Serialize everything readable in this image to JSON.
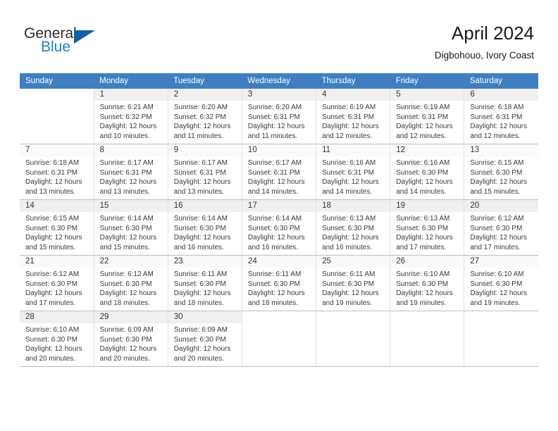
{
  "brand": {
    "name_part1": "General",
    "name_part2": "Blue",
    "triangle_icon": "triangle-logo-icon",
    "accent_color": "#1060a8",
    "blue_text_color": "#1f7fc4"
  },
  "header": {
    "title": "April 2024",
    "subtitle": "Digbohouo, Ivory Coast"
  },
  "calendar": {
    "header_bg_color": "#3f7fc1",
    "weekday_headers": [
      "Sunday",
      "Monday",
      "Tuesday",
      "Wednesday",
      "Thursday",
      "Friday",
      "Saturday"
    ],
    "weeks": [
      [
        {
          "day": "",
          "sunrise": "",
          "sunset": "",
          "daylight_line1": "",
          "daylight_line2": ""
        },
        {
          "day": "1",
          "sunrise": "Sunrise: 6:21 AM",
          "sunset": "Sunset: 6:32 PM",
          "daylight_line1": "Daylight: 12 hours",
          "daylight_line2": "and 10 minutes."
        },
        {
          "day": "2",
          "sunrise": "Sunrise: 6:20 AM",
          "sunset": "Sunset: 6:32 PM",
          "daylight_line1": "Daylight: 12 hours",
          "daylight_line2": "and 11 minutes."
        },
        {
          "day": "3",
          "sunrise": "Sunrise: 6:20 AM",
          "sunset": "Sunset: 6:31 PM",
          "daylight_line1": "Daylight: 12 hours",
          "daylight_line2": "and 11 minutes."
        },
        {
          "day": "4",
          "sunrise": "Sunrise: 6:19 AM",
          "sunset": "Sunset: 6:31 PM",
          "daylight_line1": "Daylight: 12 hours",
          "daylight_line2": "and 12 minutes."
        },
        {
          "day": "5",
          "sunrise": "Sunrise: 6:19 AM",
          "sunset": "Sunset: 6:31 PM",
          "daylight_line1": "Daylight: 12 hours",
          "daylight_line2": "and 12 minutes."
        },
        {
          "day": "6",
          "sunrise": "Sunrise: 6:18 AM",
          "sunset": "Sunset: 6:31 PM",
          "daylight_line1": "Daylight: 12 hours",
          "daylight_line2": "and 12 minutes."
        }
      ],
      [
        {
          "day": "7",
          "sunrise": "Sunrise: 6:18 AM",
          "sunset": "Sunset: 6:31 PM",
          "daylight_line1": "Daylight: 12 hours",
          "daylight_line2": "and 13 minutes."
        },
        {
          "day": "8",
          "sunrise": "Sunrise: 6:17 AM",
          "sunset": "Sunset: 6:31 PM",
          "daylight_line1": "Daylight: 12 hours",
          "daylight_line2": "and 13 minutes."
        },
        {
          "day": "9",
          "sunrise": "Sunrise: 6:17 AM",
          "sunset": "Sunset: 6:31 PM",
          "daylight_line1": "Daylight: 12 hours",
          "daylight_line2": "and 13 minutes."
        },
        {
          "day": "10",
          "sunrise": "Sunrise: 6:17 AM",
          "sunset": "Sunset: 6:31 PM",
          "daylight_line1": "Daylight: 12 hours",
          "daylight_line2": "and 14 minutes."
        },
        {
          "day": "11",
          "sunrise": "Sunrise: 6:16 AM",
          "sunset": "Sunset: 6:31 PM",
          "daylight_line1": "Daylight: 12 hours",
          "daylight_line2": "and 14 minutes."
        },
        {
          "day": "12",
          "sunrise": "Sunrise: 6:16 AM",
          "sunset": "Sunset: 6:30 PM",
          "daylight_line1": "Daylight: 12 hours",
          "daylight_line2": "and 14 minutes."
        },
        {
          "day": "13",
          "sunrise": "Sunrise: 6:15 AM",
          "sunset": "Sunset: 6:30 PM",
          "daylight_line1": "Daylight: 12 hours",
          "daylight_line2": "and 15 minutes."
        }
      ],
      [
        {
          "day": "14",
          "sunrise": "Sunrise: 6:15 AM",
          "sunset": "Sunset: 6:30 PM",
          "daylight_line1": "Daylight: 12 hours",
          "daylight_line2": "and 15 minutes."
        },
        {
          "day": "15",
          "sunrise": "Sunrise: 6:14 AM",
          "sunset": "Sunset: 6:30 PM",
          "daylight_line1": "Daylight: 12 hours",
          "daylight_line2": "and 15 minutes."
        },
        {
          "day": "16",
          "sunrise": "Sunrise: 6:14 AM",
          "sunset": "Sunset: 6:30 PM",
          "daylight_line1": "Daylight: 12 hours",
          "daylight_line2": "and 16 minutes."
        },
        {
          "day": "17",
          "sunrise": "Sunrise: 6:14 AM",
          "sunset": "Sunset: 6:30 PM",
          "daylight_line1": "Daylight: 12 hours",
          "daylight_line2": "and 16 minutes."
        },
        {
          "day": "18",
          "sunrise": "Sunrise: 6:13 AM",
          "sunset": "Sunset: 6:30 PM",
          "daylight_line1": "Daylight: 12 hours",
          "daylight_line2": "and 16 minutes."
        },
        {
          "day": "19",
          "sunrise": "Sunrise: 6:13 AM",
          "sunset": "Sunset: 6:30 PM",
          "daylight_line1": "Daylight: 12 hours",
          "daylight_line2": "and 17 minutes."
        },
        {
          "day": "20",
          "sunrise": "Sunrise: 6:12 AM",
          "sunset": "Sunset: 6:30 PM",
          "daylight_line1": "Daylight: 12 hours",
          "daylight_line2": "and 17 minutes."
        }
      ],
      [
        {
          "day": "21",
          "sunrise": "Sunrise: 6:12 AM",
          "sunset": "Sunset: 6:30 PM",
          "daylight_line1": "Daylight: 12 hours",
          "daylight_line2": "and 17 minutes."
        },
        {
          "day": "22",
          "sunrise": "Sunrise: 6:12 AM",
          "sunset": "Sunset: 6:30 PM",
          "daylight_line1": "Daylight: 12 hours",
          "daylight_line2": "and 18 minutes."
        },
        {
          "day": "23",
          "sunrise": "Sunrise: 6:11 AM",
          "sunset": "Sunset: 6:30 PM",
          "daylight_line1": "Daylight: 12 hours",
          "daylight_line2": "and 18 minutes."
        },
        {
          "day": "24",
          "sunrise": "Sunrise: 6:11 AM",
          "sunset": "Sunset: 6:30 PM",
          "daylight_line1": "Daylight: 12 hours",
          "daylight_line2": "and 18 minutes."
        },
        {
          "day": "25",
          "sunrise": "Sunrise: 6:11 AM",
          "sunset": "Sunset: 6:30 PM",
          "daylight_line1": "Daylight: 12 hours",
          "daylight_line2": "and 19 minutes."
        },
        {
          "day": "26",
          "sunrise": "Sunrise: 6:10 AM",
          "sunset": "Sunset: 6:30 PM",
          "daylight_line1": "Daylight: 12 hours",
          "daylight_line2": "and 19 minutes."
        },
        {
          "day": "27",
          "sunrise": "Sunrise: 6:10 AM",
          "sunset": "Sunset: 6:30 PM",
          "daylight_line1": "Daylight: 12 hours",
          "daylight_line2": "and 19 minutes."
        }
      ],
      [
        {
          "day": "28",
          "sunrise": "Sunrise: 6:10 AM",
          "sunset": "Sunset: 6:30 PM",
          "daylight_line1": "Daylight: 12 hours",
          "daylight_line2": "and 20 minutes."
        },
        {
          "day": "29",
          "sunrise": "Sunrise: 6:09 AM",
          "sunset": "Sunset: 6:30 PM",
          "daylight_line1": "Daylight: 12 hours",
          "daylight_line2": "and 20 minutes."
        },
        {
          "day": "30",
          "sunrise": "Sunrise: 6:09 AM",
          "sunset": "Sunset: 6:30 PM",
          "daylight_line1": "Daylight: 12 hours",
          "daylight_line2": "and 20 minutes."
        },
        {
          "day": "",
          "sunrise": "",
          "sunset": "",
          "daylight_line1": "",
          "daylight_line2": ""
        },
        {
          "day": "",
          "sunrise": "",
          "sunset": "",
          "daylight_line1": "",
          "daylight_line2": ""
        },
        {
          "day": "",
          "sunrise": "",
          "sunset": "",
          "daylight_line1": "",
          "daylight_line2": ""
        },
        {
          "day": "",
          "sunrise": "",
          "sunset": "",
          "daylight_line1": "",
          "daylight_line2": ""
        }
      ]
    ]
  }
}
